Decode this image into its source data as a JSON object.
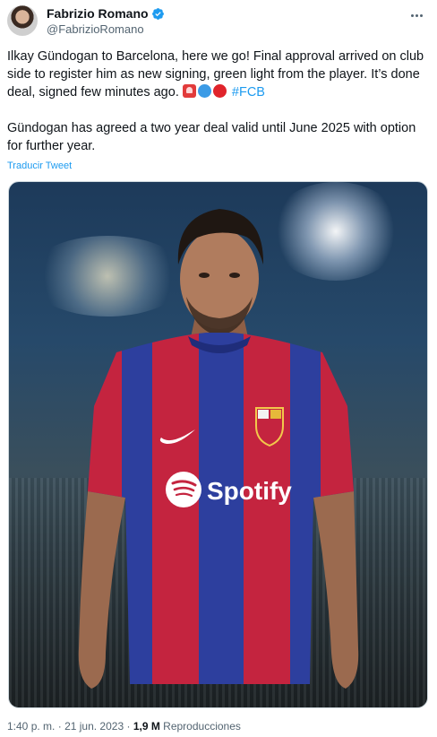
{
  "author": {
    "display_name": "Fabrizio Romano",
    "handle": "@FabrizioRomano",
    "verified_icon": "verified-badge-icon",
    "verified_color": "#1d9bf0"
  },
  "tweet": {
    "paragraph1": "Ilkay Gündogan to Barcelona, here we go! Final approval arrived on club side to register him as new signing, green light from the player. It’s done deal, signed few minutes ago.",
    "emojis": [
      "siren-emoji",
      "blue-circle-emoji",
      "red-circle-emoji"
    ],
    "hashtag": "#FCB",
    "paragraph2": "Gündogan has agreed a two year deal valid until June 2025 with option for further year.",
    "translate_link": "Traducir Tweet"
  },
  "media": {
    "shirt_sponsor": "Spotify",
    "shirt_colors": {
      "blue": "#2d3f9e",
      "red": "#c4243f"
    }
  },
  "meta": {
    "time": "1:40 p. m.",
    "separator1": "·",
    "date": "21 jun. 2023",
    "separator2": "·",
    "views_count": "1,9 M",
    "views_label": "Reproducciones"
  },
  "colors": {
    "link": "#1d9bf0",
    "secondary_text": "#536471",
    "primary_text": "#0f1419"
  }
}
